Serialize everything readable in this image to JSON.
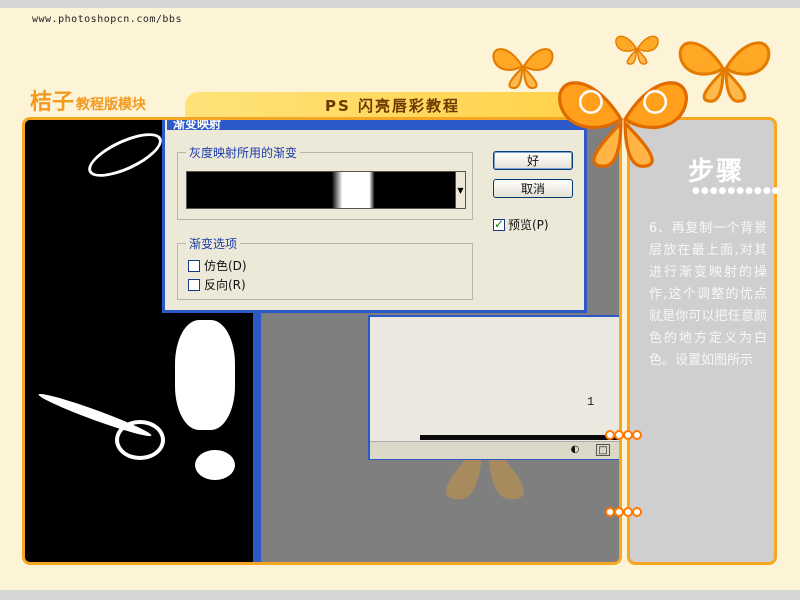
{
  "site_url": "www.photoshopcn.com/bbs",
  "logo": {
    "main": "桔子",
    "sub": "教程版模块"
  },
  "tutorial_title": "PS 闪亮唇彩教程",
  "dialog": {
    "title": "渐变映射",
    "group_gradient_label": "灰度映射所用的渐变",
    "group_options_label": "渐变选项",
    "dither_label": "仿色(D)",
    "reverse_label": "反向(R)",
    "dither_checked": false,
    "reverse_checked": false,
    "ok_label": "好",
    "cancel_label": "取消",
    "preview_label": "预览(P)",
    "preview_checked": true
  },
  "background_window": {
    "value_fragment": "1"
  },
  "sidebar": {
    "heading": "步骤",
    "dots": "●●●●●●●●●●",
    "step_text": "6、再复制一个背景层放在最上面,对其进行渐变映射的操作,这个调整的优点就是你可以把任意颜色的地方定义为白色。设置如图所示"
  },
  "colors": {
    "accent": "#f5a623",
    "panel": "#cfcfcf",
    "xp_blue": "#2d58c8"
  },
  "icons": [
    "butterfly-icon",
    "adjustment-icon",
    "new-layer-icon",
    "dropdown-arrow-icon",
    "checkmark-icon",
    "ring-icon"
  ]
}
